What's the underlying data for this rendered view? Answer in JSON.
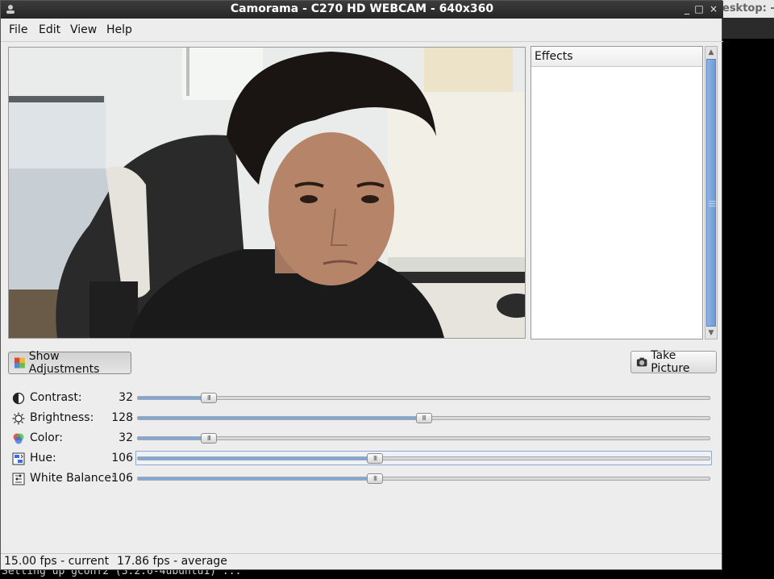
{
  "window": {
    "title": "Camorama - C270 HD WEBCAM - 640x360",
    "controls": {
      "minimize": "_",
      "maximize": "□",
      "close": "×"
    }
  },
  "menu": [
    {
      "label": "File",
      "mnemonic": "F"
    },
    {
      "label": "Edit",
      "mnemonic": "E"
    },
    {
      "label": "View",
      "mnemonic": "V"
    },
    {
      "label": "Help",
      "mnemonic": "H"
    }
  ],
  "effects": {
    "header": "Effects"
  },
  "buttons": {
    "show_adjustments": "Show Adjustments",
    "take_picture": "Take Picture"
  },
  "adjustments": [
    {
      "label": "Contrast:",
      "value": "32",
      "fraction": 0.125,
      "icon": "contrast-icon"
    },
    {
      "label": "Brightness:",
      "value": "128",
      "fraction": 0.5,
      "icon": "brightness-icon"
    },
    {
      "label": "Color:",
      "value": "32",
      "fraction": 0.125,
      "icon": "color-icon"
    },
    {
      "label": "Hue:",
      "value": "106",
      "fraction": 0.415,
      "icon": "hue-icon"
    },
    {
      "label": "White Balance:",
      "value": "106",
      "fraction": 0.415,
      "icon": "white-balance-icon"
    }
  ],
  "status": {
    "current": "15.00 fps - current",
    "average": "17.86 fps - average"
  },
  "background": {
    "right_text": "esktop: -",
    "bottom_text": "Setting up gconf2 (3.2.6-4ubuntu1) ..."
  }
}
